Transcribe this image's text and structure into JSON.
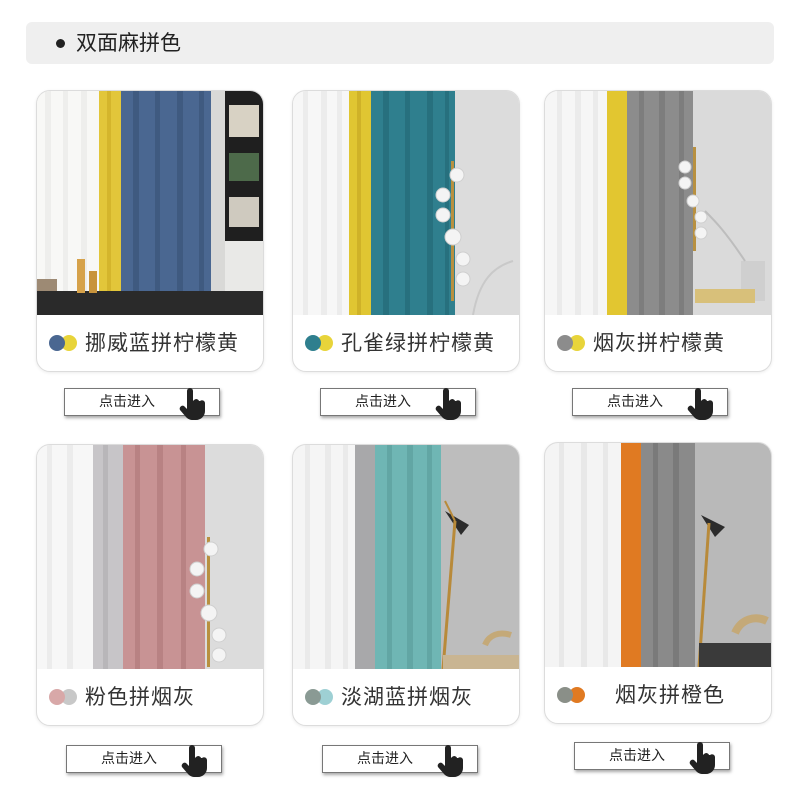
{
  "header": {
    "title": "双面麻拼色"
  },
  "button_label": "点击进入",
  "cards": [
    {
      "name": "挪威蓝拼柠檬黄",
      "colors": [
        "#4a6791",
        "#e8d43a"
      ]
    },
    {
      "name": "孔雀绿拼柠檬黄",
      "colors": [
        "#2f7f8e",
        "#e8d43a"
      ]
    },
    {
      "name": "烟灰拼柠檬黄",
      "colors": [
        "#8c8c8c",
        "#e8d43a"
      ]
    },
    {
      "name": "粉色拼烟灰",
      "colors": [
        "#d8a8a8",
        "#c8c8c8"
      ]
    },
    {
      "name": "淡湖蓝拼烟灰",
      "colors": [
        "#8a9a94",
        "#9ed0d4"
      ]
    },
    {
      "name": "烟灰拼橙色",
      "colors": [
        "#8a8f88",
        "#e07a22"
      ]
    }
  ]
}
